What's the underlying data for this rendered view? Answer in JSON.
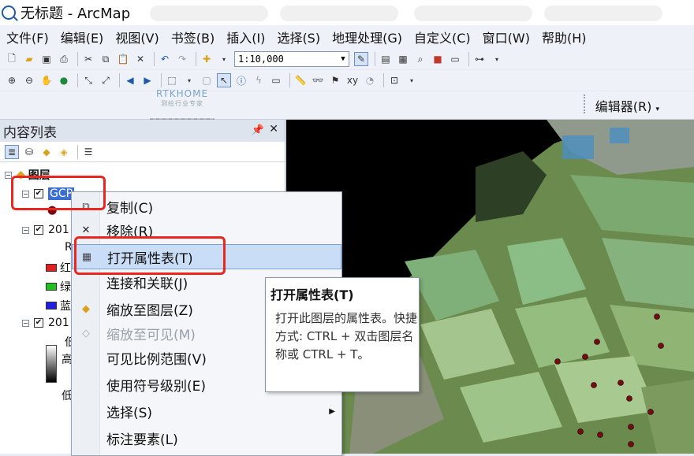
{
  "window": {
    "title": "无标题 - ArcMap"
  },
  "menubar": {
    "items": [
      "文件(F)",
      "编辑(E)",
      "视图(V)",
      "书签(B)",
      "插入(I)",
      "选择(S)",
      "地理处理(G)",
      "自定义(C)",
      "窗口(W)",
      "帮助(H)"
    ]
  },
  "toolbar": {
    "scale_value": "1:10,000"
  },
  "editor_toolbar": {
    "label": "编辑器(R)"
  },
  "watermark": {
    "brand": "RTKHOME",
    "tagline": "测绘行业专家"
  },
  "toc": {
    "title": "内容列表",
    "root_label": "图层",
    "layers": [
      {
        "label": "GCP"
      },
      {
        "label": "201",
        "band_label": "R",
        "bands": [
          {
            "label": "红",
            "color": "#e02020"
          },
          {
            "label": "绿",
            "color": "#20c020"
          },
          {
            "label": "蓝",
            "color": "#2020e0"
          }
        ]
      },
      {
        "label": "201",
        "legend_high_prefix": "低",
        "legend_high": "高",
        "legend_low": "低"
      }
    ]
  },
  "context_menu": {
    "items": [
      {
        "label": "复制(C)",
        "icon": "copy-icon",
        "enabled": true
      },
      {
        "label": "移除(R)",
        "icon": "remove-icon",
        "enabled": true
      },
      {
        "label": "打开属性表(T)",
        "icon": "table-icon",
        "enabled": true,
        "highlighted": true
      },
      {
        "label": "连接和关联(J)",
        "icon": "",
        "enabled": true
      },
      {
        "label": "缩放至图层(Z)",
        "icon": "zoom-to-layer-icon",
        "enabled": true
      },
      {
        "label": "缩放至可见(M)",
        "icon": "zoom-visible-icon",
        "enabled": false
      },
      {
        "label": "可见比例范围(V)",
        "icon": "",
        "enabled": true
      },
      {
        "label": "使用符号级别(E)",
        "icon": "",
        "enabled": true
      },
      {
        "label": "选择(S)",
        "icon": "",
        "enabled": true,
        "submenu": true
      },
      {
        "label": "标注要素(L)",
        "icon": "",
        "enabled": true
      }
    ]
  },
  "tooltip": {
    "title": "打开属性表(T)",
    "body": "打开此图层的属性表。快捷方式: CTRL + 双击图层名称或 CTRL + T。"
  },
  "colors": {
    "highlight": "#c9ddf6",
    "callout_red": "#e8281f",
    "gcp_marker": "#7a0a12"
  }
}
